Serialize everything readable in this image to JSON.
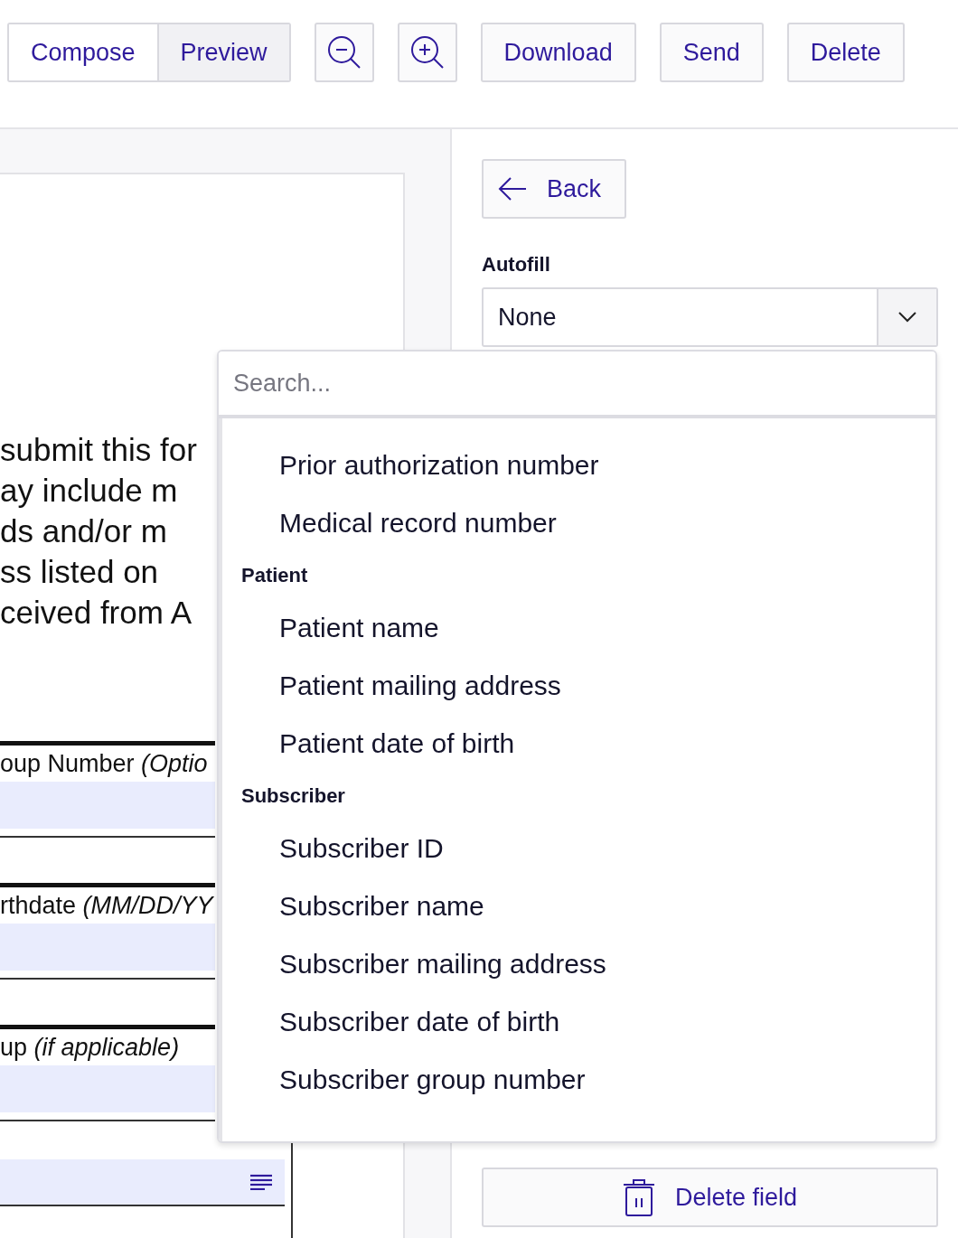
{
  "toolbar": {
    "tabs": [
      {
        "label": "Compose",
        "selected": false
      },
      {
        "label": "Preview",
        "selected": true
      }
    ],
    "buttons": [
      {
        "kind": "zoom-out"
      },
      {
        "kind": "zoom-in"
      },
      {
        "kind": "text",
        "label": "Download"
      },
      {
        "kind": "text",
        "label": "Send"
      },
      {
        "kind": "text",
        "label": "Delete"
      }
    ]
  },
  "document": {
    "paragraph_lines": [
      "submit this for",
      "ay include m",
      "ds and/or m",
      "ss listed on",
      "ceived from A"
    ],
    "fields": [
      {
        "kind": "labeled",
        "label": "oup Number *(Optio*"
      },
      {
        "kind": "labeled",
        "label": "rthdate *(MM/DD/YY*"
      },
      {
        "kind": "labeled",
        "label": "up *(if applicable)*"
      },
      {
        "kind": "multiline"
      }
    ]
  },
  "panel": {
    "back_button": "Back",
    "autofill_label": "Autofill",
    "autofill_value": "None",
    "delete_button": "Delete field"
  },
  "dropdown": {
    "placeholder": "Search...",
    "options": [
      {
        "kind": "item",
        "label": "Prior authorization number"
      },
      {
        "kind": "item",
        "label": "Medical record number"
      },
      {
        "kind": "group",
        "label": "Patient"
      },
      {
        "kind": "item",
        "label": "Patient name"
      },
      {
        "kind": "item",
        "label": "Patient mailing address"
      },
      {
        "kind": "item",
        "label": "Patient date of birth"
      },
      {
        "kind": "group",
        "label": "Subscriber"
      },
      {
        "kind": "item",
        "label": "Subscriber ID"
      },
      {
        "kind": "item",
        "label": "Subscriber name"
      },
      {
        "kind": "item",
        "label": "Subscriber mailing address"
      },
      {
        "kind": "item",
        "label": "Subscriber date of birth"
      },
      {
        "kind": "item",
        "label": "Subscriber group number"
      }
    ]
  }
}
